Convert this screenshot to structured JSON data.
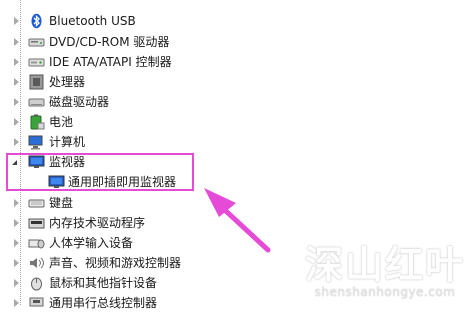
{
  "tree": {
    "items": [
      {
        "label": "Bluetooth USB",
        "icon": "bluetooth-icon"
      },
      {
        "label": "DVD/CD-ROM 驱动器",
        "icon": "dvd-drive-icon"
      },
      {
        "label": "IDE ATA/ATAPI 控制器",
        "icon": "ide-controller-icon"
      },
      {
        "label": "处理器",
        "icon": "processor-icon"
      },
      {
        "label": "磁盘驱动器",
        "icon": "disk-drive-icon"
      },
      {
        "label": "电池",
        "icon": "battery-icon"
      },
      {
        "label": "计算机",
        "icon": "computer-icon"
      },
      {
        "label": "监视器",
        "icon": "monitor-icon",
        "expanded": true,
        "children": [
          {
            "label": "通用即插即用监视器",
            "icon": "monitor-icon"
          }
        ]
      },
      {
        "label": "键盘",
        "icon": "keyboard-icon"
      },
      {
        "label": "内存技术驱动程序",
        "icon": "memory-icon"
      },
      {
        "label": "人体学输入设备",
        "icon": "hid-icon"
      },
      {
        "label": "声音、视频和游戏控制器",
        "icon": "sound-icon"
      },
      {
        "label": "鼠标和其他指针设备",
        "icon": "mouse-icon"
      },
      {
        "label": "通用串行总线控制器",
        "icon": "usb-icon"
      }
    ]
  },
  "annotation": {
    "color": "#e64bd8"
  },
  "watermark": {
    "big": "深山红叶",
    "small": "shenshanhongye.com"
  }
}
